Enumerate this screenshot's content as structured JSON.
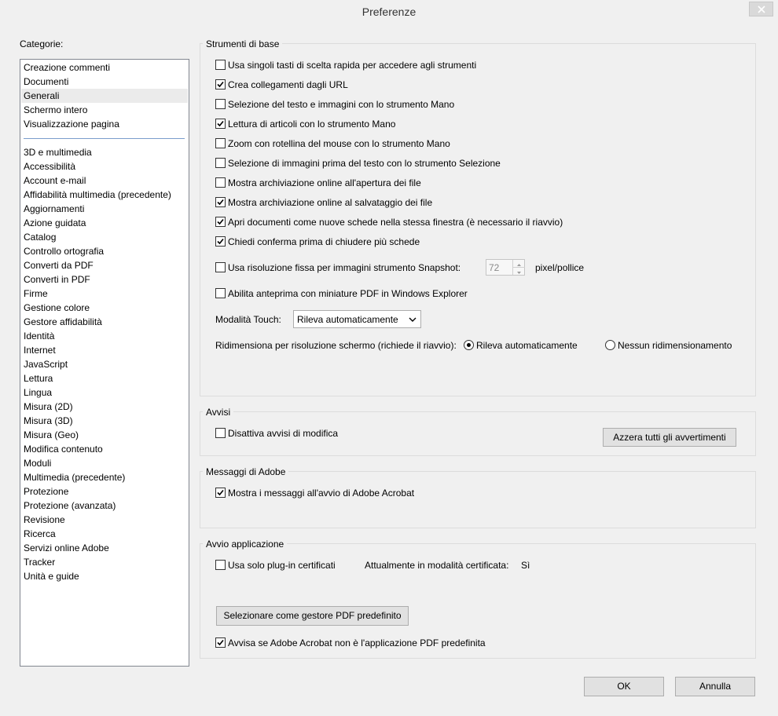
{
  "window": {
    "title": "Preferenze"
  },
  "categories": {
    "label": "Categorie:",
    "top_items": [
      "Creazione commenti",
      "Documenti",
      "Generali",
      "Schermo intero",
      "Visualizzazione pagina"
    ],
    "selected": "Generali",
    "items": [
      "3D e multimedia",
      "Accessibilità",
      "Account e-mail",
      "Affidabilità multimedia (precedente)",
      "Aggiornamenti",
      "Azione guidata",
      "Catalog",
      "Controllo ortografia",
      "Converti da PDF",
      "Converti in PDF",
      "Firme",
      "Gestione colore",
      "Gestore affidabilità",
      "Identità",
      "Internet",
      "JavaScript",
      "Lettura",
      "Lingua",
      "Misura (2D)",
      "Misura (3D)",
      "Misura (Geo)",
      "Modifica contenuto",
      "Moduli",
      "Multimedia (precedente)",
      "Protezione",
      "Protezione (avanzata)",
      "Revisione",
      "Ricerca",
      "Servizi online Adobe",
      "Tracker",
      "Unità e guide"
    ]
  },
  "basic_tools": {
    "title": "Strumenti di base",
    "options": [
      {
        "label": "Usa singoli tasti di scelta rapida per accedere agli strumenti",
        "checked": false
      },
      {
        "label": "Crea collegamenti dagli URL",
        "checked": true
      },
      {
        "label": "Selezione del testo e immagini con lo strumento Mano",
        "checked": false
      },
      {
        "label": "Lettura di articoli con lo strumento Mano",
        "checked": true
      },
      {
        "label": "Zoom con rotellina del mouse con lo strumento Mano",
        "checked": false
      },
      {
        "label": "Selezione di immagini prima del testo con lo strumento Selezione",
        "checked": false
      },
      {
        "label": "Mostra archiviazione online all'apertura dei file",
        "checked": false
      },
      {
        "label": "Mostra archiviazione online al salvataggio dei file",
        "checked": true
      },
      {
        "label": "Apri documenti come nuove schede nella stessa finestra (è necessario il riavvio)",
        "checked": true
      },
      {
        "label": "Chiedi conferma prima di chiudere più schede",
        "checked": true
      }
    ],
    "snapshot": {
      "label": "Usa risoluzione fissa per immagini strumento Snapshot:",
      "checked": false,
      "value": "72",
      "unit": "pixel/pollice"
    },
    "thumbnails": {
      "label": "Abilita anteprima con miniature PDF in Windows Explorer",
      "checked": false
    },
    "touch_mode": {
      "label": "Modalità Touch:",
      "value": "Rileva automaticamente"
    },
    "resize": {
      "label": "Ridimensiona per risoluzione schermo (richiede il riavvio):",
      "option_auto": "Rileva automaticamente",
      "option_none": "Nessun ridimensionamento",
      "selected": "Rileva automaticamente"
    }
  },
  "warnings": {
    "title": "Avvisi",
    "disable_label": "Disattiva avvisi di modifica",
    "disable_checked": false,
    "reset_button": "Azzera tutti gli avvertimenti"
  },
  "adobe_messages": {
    "title": "Messaggi di Adobe",
    "show_label": "Mostra i messaggi all'avvio di Adobe Acrobat",
    "show_checked": true
  },
  "app_startup": {
    "title": "Avvio applicazione",
    "certified_label": "Usa solo plug-in certificati",
    "certified_checked": false,
    "current_mode_label": "Attualmente in modalità certificata:",
    "current_mode_value": "Sì",
    "default_handler_button": "Selezionare come gestore PDF predefinito",
    "warn_label": "Avvisa se Adobe Acrobat non è l'applicazione PDF predefinita",
    "warn_checked": true
  },
  "footer": {
    "ok": "OK",
    "cancel": "Annulla"
  }
}
